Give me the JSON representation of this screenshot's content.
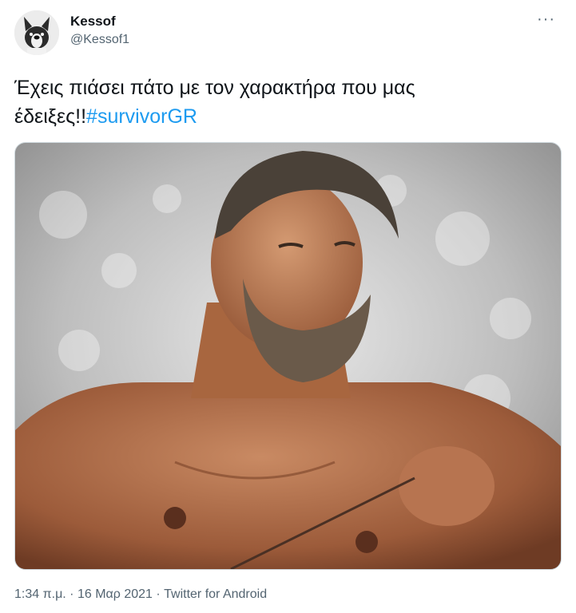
{
  "author": {
    "display_name": "Kessof",
    "handle": "@Kessof1",
    "avatar_icon": "french-bulldog-avatar"
  },
  "more_icon": "more-options-icon",
  "more_glyph": "···",
  "tweet": {
    "text": "Έχεις πιάσει πάτο με τον χαρακτήρα που μας έδειξες!!",
    "hashtag": "#survivorGR"
  },
  "media": {
    "subject": "shirtless bearded man holding a string"
  },
  "meta": {
    "time": "1:34 π.μ.",
    "separator": " · ",
    "date": "16 Μαρ 2021",
    "source": "Twitter for Android"
  },
  "colors": {
    "text": "#0f1419",
    "secondary": "#536471",
    "link": "#1d9bf0"
  }
}
